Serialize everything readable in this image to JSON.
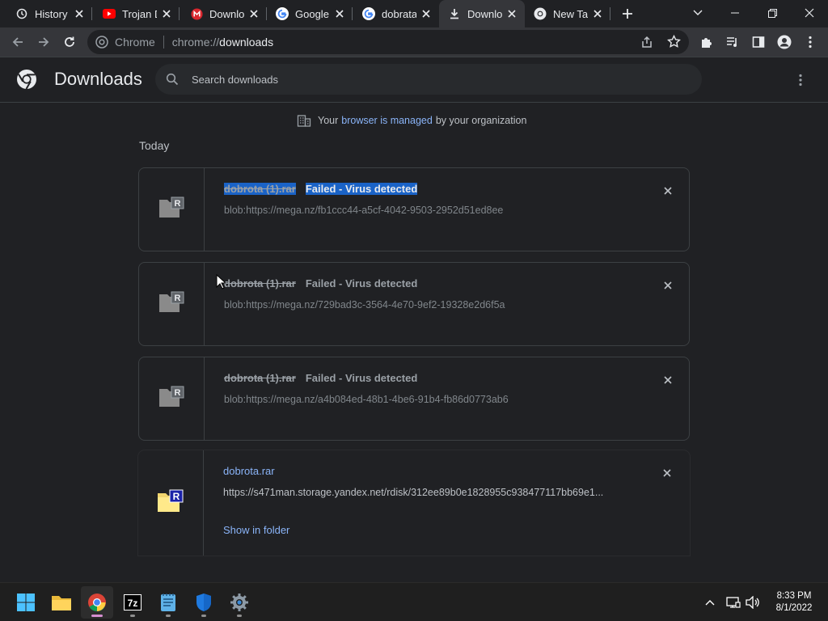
{
  "tabs": [
    {
      "label": "History",
      "icon": "history-icon"
    },
    {
      "label": "Trojan D",
      "icon": "youtube-icon"
    },
    {
      "label": "Downlo",
      "icon": "mega-icon"
    },
    {
      "label": "Google",
      "icon": "google-icon"
    },
    {
      "label": "dobrata",
      "icon": "google-icon"
    },
    {
      "label": "Downlo",
      "icon": "download-icon",
      "active": true
    },
    {
      "label": "New Tal",
      "icon": "chrome-icon"
    }
  ],
  "omnibox": {
    "label": "Chrome",
    "scheme": "chrome://",
    "host": "downloads"
  },
  "header": {
    "title": "Downloads",
    "search_placeholder": "Search downloads"
  },
  "managed": {
    "prefix": "Your",
    "link": "browser is managed",
    "suffix": "by your organization"
  },
  "section_label": "Today",
  "downloads": [
    {
      "filename": "dobrota (1).rar",
      "status": "Failed - Virus detected",
      "url": "blob:https://mega.nz/fb1ccc44-a5cf-4042-9503-2952d51ed8ee",
      "failed": true,
      "selected": true
    },
    {
      "filename": "dobrota (1).rar",
      "status": "Failed - Virus detected",
      "url": "blob:https://mega.nz/729bad3c-3564-4e70-9ef2-19328e2d6f5a",
      "failed": true
    },
    {
      "filename": "dobrota (1).rar",
      "status": "Failed - Virus detected",
      "url": "blob:https://mega.nz/a4b084ed-48b1-4be6-91b4-fb86d0773ab6",
      "failed": true
    },
    {
      "filename": "dobrota.rar",
      "status": "",
      "url": "https://s471man.storage.yandex.net/rdisk/312ee89b0e1828955c938477117bb69e1...",
      "failed": false,
      "action": "Show in folder"
    }
  ],
  "taskbar": {
    "apps": [
      "start-icon",
      "file-explorer-icon",
      "chrome-icon",
      "7zip-icon",
      "notepad-icon",
      "defender-icon",
      "settings-icon"
    ],
    "time": "8:33 PM",
    "date": "8/1/2022"
  },
  "colors": {
    "background": "#202124",
    "toolbar": "#35363a",
    "link": "#8ab4f8",
    "selection": "#1a63c7"
  }
}
